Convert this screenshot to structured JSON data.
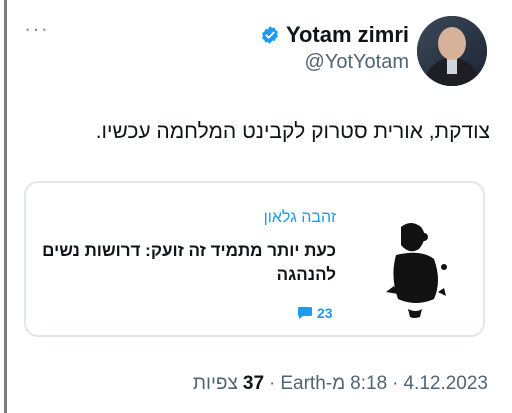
{
  "tweet": {
    "more_icon": "more-horizontal-icon",
    "author": {
      "name": "Yotam zimri",
      "handle": "@YotYotam",
      "verified_color": "#1d9bf0"
    },
    "text": "צודקת, אורית סטרוק לקבינט המלחמה עכשיו.",
    "card": {
      "author": "זהבה גלאון",
      "headline": "כעת יותר מתמיד זה זועק: דרושות נשים להנהגה",
      "comments_count": "23",
      "accent_color": "#1d9bf0"
    },
    "meta": {
      "date": "4.12.2023",
      "separator1": "·",
      "time": "8:18",
      "source": "Earth-מ",
      "separator2": "·",
      "views_count": "37",
      "views_label": "צפיות"
    }
  }
}
